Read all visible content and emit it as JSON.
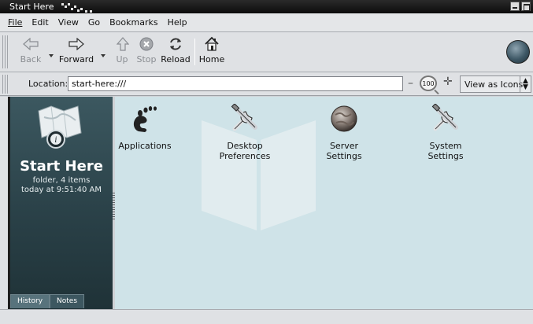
{
  "window": {
    "title": "Start Here"
  },
  "menubar": {
    "items": [
      {
        "label": "File",
        "mnemonic": "F"
      },
      {
        "label": "Edit",
        "mnemonic": "E"
      },
      {
        "label": "View",
        "mnemonic": "V"
      },
      {
        "label": "Go",
        "mnemonic": "G"
      },
      {
        "label": "Bookmarks",
        "mnemonic": "B"
      },
      {
        "label": "Help",
        "mnemonic": "H"
      }
    ]
  },
  "toolbar": {
    "back_label": "Back",
    "forward_label": "Forward",
    "up_label": "Up",
    "stop_label": "Stop",
    "reload_label": "Reload",
    "home_label": "Home"
  },
  "location": {
    "label": "Location:",
    "value": "start-here:///",
    "zoom_level": "100",
    "view_as": "View as Icons"
  },
  "sidepane": {
    "title": "Start Here",
    "info_line1": "folder, 4 items",
    "info_line2": "today at 9:51:40 AM",
    "tabs": [
      "History",
      "Notes"
    ]
  },
  "content": {
    "items": [
      {
        "label": "Applications",
        "icon": "gnome-foot-icon"
      },
      {
        "label": "Desktop Preferences",
        "icon": "tools-icon"
      },
      {
        "label": "Server Settings",
        "icon": "globe-icon"
      },
      {
        "label": "System Settings",
        "icon": "tools-icon"
      }
    ]
  },
  "colors": {
    "sidepane": "#2f4a51",
    "content_bg": "#cfe3e8",
    "titlebar": "#111111"
  }
}
